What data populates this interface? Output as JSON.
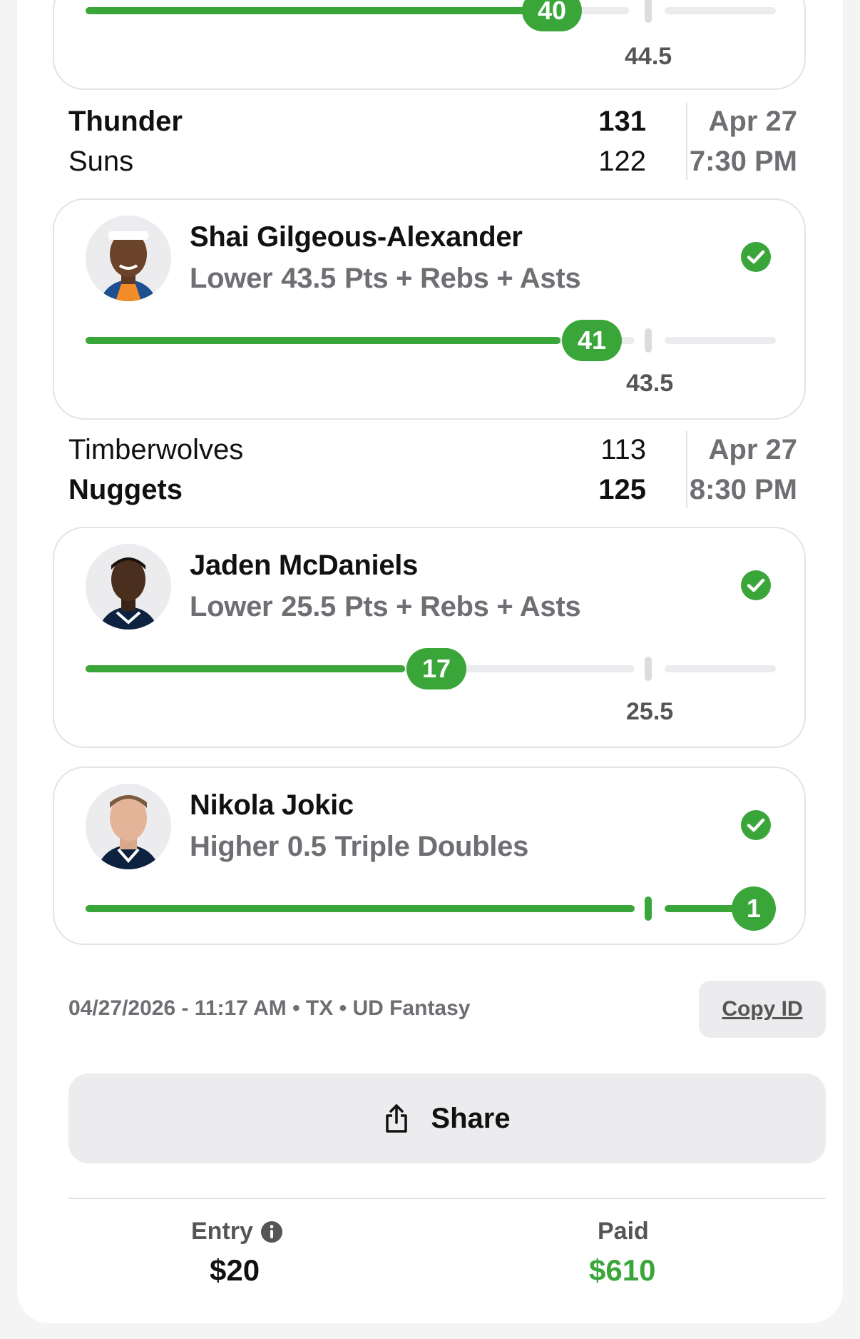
{
  "top_partial": {
    "progress_value": "40",
    "line_value": "44.5"
  },
  "games": [
    {
      "team1": "Thunder",
      "score1": "131",
      "team2": "Suns",
      "score2": "122",
      "date": "Apr 27",
      "time": "7:30 PM"
    },
    {
      "team1": "Timberwolves",
      "score1": "113",
      "team2": "Nuggets",
      "score2": "125",
      "date": "Apr 27",
      "time": "8:30 PM"
    }
  ],
  "picks": [
    {
      "player": "Shai Gilgeous-Alexander",
      "direction": "Lower",
      "line": "43.5",
      "stat": "Pts + Rebs + Asts",
      "result": "41",
      "line_label": "43.5",
      "progress_fraction": 0.943
    },
    {
      "player": "Jaden McDaniels",
      "direction": "Lower",
      "line": "25.5",
      "stat": "Pts + Rebs + Asts",
      "result": "17",
      "line_label": "25.5",
      "progress_fraction": 0.667
    },
    {
      "player": "Nikola Jokic",
      "direction": "Higher",
      "line": "0.5",
      "stat": "Triple Doubles",
      "result": "1",
      "progress_fraction": 1.0
    }
  ],
  "footer": {
    "meta": "04/27/2026 - 11:17 AM • TX • UD Fantasy",
    "copy_id_label": "Copy ID",
    "share_label": "Share",
    "entry_label": "Entry",
    "entry_value": "$20",
    "paid_label": "Paid",
    "paid_value": "$610"
  },
  "colors": {
    "accent_green": "#3aa63a",
    "paid_green": "#3aa63a",
    "muted_text": "#6e6e73"
  },
  "icons": [
    "check-circle-icon",
    "share-icon",
    "info-icon"
  ]
}
